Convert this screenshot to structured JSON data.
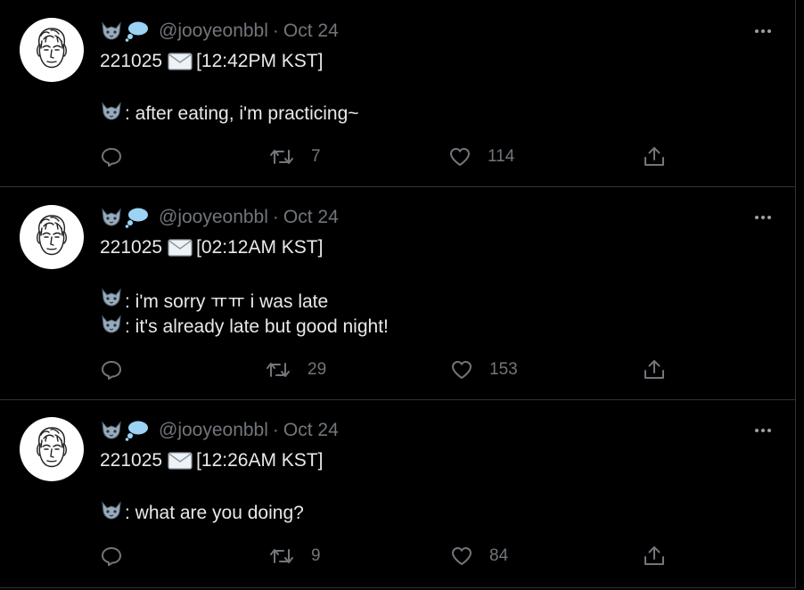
{
  "tweets": [
    {
      "handle": "@jooyeonbbl",
      "separator": "·",
      "date": "Oct 24",
      "header_date": "221025",
      "time_label": "[12:42PM KST]",
      "lines": [
        ": after eating, i'm practicing~"
      ],
      "retweets": "7",
      "likes": "114"
    },
    {
      "handle": "@jooyeonbbl",
      "separator": "·",
      "date": "Oct 24",
      "header_date": "221025",
      "time_label": "[02:12AM KST]",
      "lines": [
        ": i'm sorry ㅠㅠ i was late",
        ": it's already late but good night!"
      ],
      "retweets": "29",
      "likes": "153"
    },
    {
      "handle": "@jooyeonbbl",
      "separator": "·",
      "date": "Oct 24",
      "header_date": "221025",
      "time_label": "[12:26AM KST]",
      "lines": [
        ": what are you doing?"
      ],
      "retweets": "9",
      "likes": "84"
    }
  ],
  "icons": {
    "author_emoji": [
      "wolf-icon",
      "thought-bubble-icon"
    ],
    "line_emoji": "wolf-icon",
    "envelope": "envelope-icon",
    "actions": [
      "reply-icon",
      "retweet-icon",
      "like-icon",
      "share-icon"
    ],
    "more": "more-options-icon"
  },
  "colors": {
    "background": "#000000",
    "text": "#e7e9ea",
    "muted": "#71767b",
    "divider": "#2f3336"
  }
}
